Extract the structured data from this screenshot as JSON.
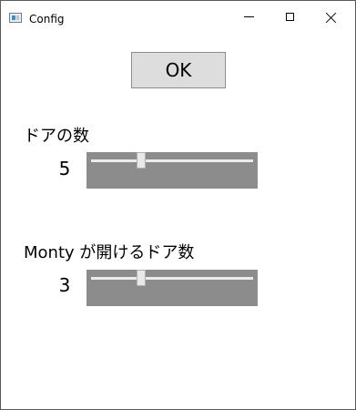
{
  "window": {
    "title": "Config",
    "icon": "app-window-icon",
    "controls": {
      "minimize": "minimize-icon",
      "maximize": "maximize-icon",
      "close": "close-icon"
    }
  },
  "ok_button": {
    "label": "OK"
  },
  "settings": [
    {
      "label": "ドアの数",
      "value": "5",
      "slider_fraction": 0.3
    },
    {
      "label": "Monty が開けるドア数",
      "value": "3",
      "slider_fraction": 0.3
    }
  ],
  "colors": {
    "slider_background": "#8c8c8c",
    "slider_track": "#ebebeb",
    "button_background": "#dddddd"
  }
}
